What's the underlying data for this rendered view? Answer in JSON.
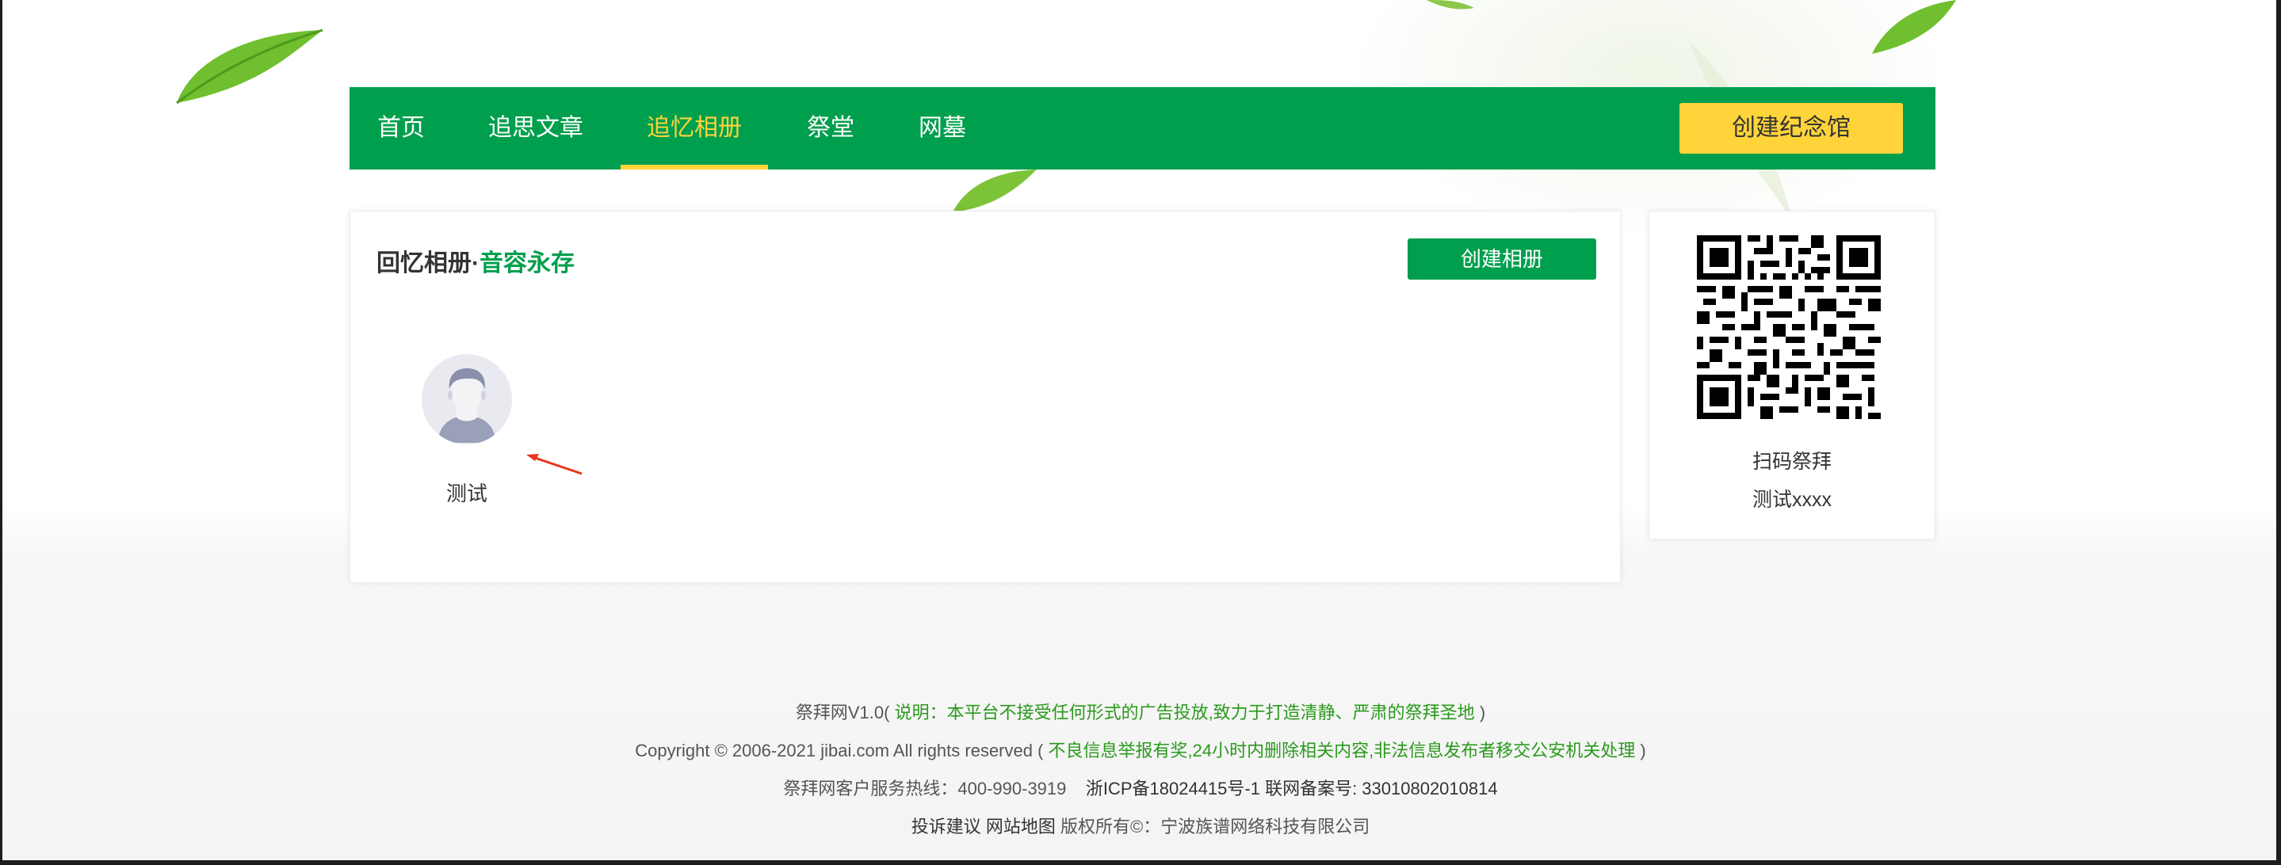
{
  "nav": {
    "items": [
      {
        "label": "首页",
        "active": false
      },
      {
        "label": "追思文章",
        "active": false
      },
      {
        "label": "追忆相册",
        "active": true
      },
      {
        "label": "祭堂",
        "active": false
      },
      {
        "label": "网墓",
        "active": false
      }
    ],
    "create_memorial_label": "创建纪念馆"
  },
  "album": {
    "title_prefix": "回忆相册·",
    "title_highlight": "音容永存",
    "create_button_label": "创建相册",
    "items": [
      {
        "name": "测试"
      }
    ]
  },
  "sidebar": {
    "scan_label": "扫码祭拜",
    "memorial_name": "测试xxxx"
  },
  "footer": {
    "line1_prefix": "祭拜网V1.0(",
    "line1_note": "说明：本平台不接受任何形式的广告投放,致力于打造清静、严肃的祭拜圣地",
    "line1_suffix": ")",
    "line2_prefix": "Copyright © 2006-2021 jibai.com All rights reserved (",
    "line2_note": "不良信息举报有奖,24小时内删除相关内容,非法信息发布者移交公安机关处理",
    "line2_suffix": ")",
    "hotline": "祭拜网客户服务热线：400-990-3919",
    "icp": "浙ICP备18024415号-1 联网备案号: 33010802010814",
    "complaint_link": "投诉建议",
    "sitemap_link": "网站地图",
    "copyright_owner": "版权所有©：宁波族谱网络科技有限公司"
  },
  "colors": {
    "brand_green": "#009f4d",
    "accent_yellow": "#ffd43a",
    "note_green": "#2a9a1c",
    "arrow_red": "#e8341c"
  }
}
